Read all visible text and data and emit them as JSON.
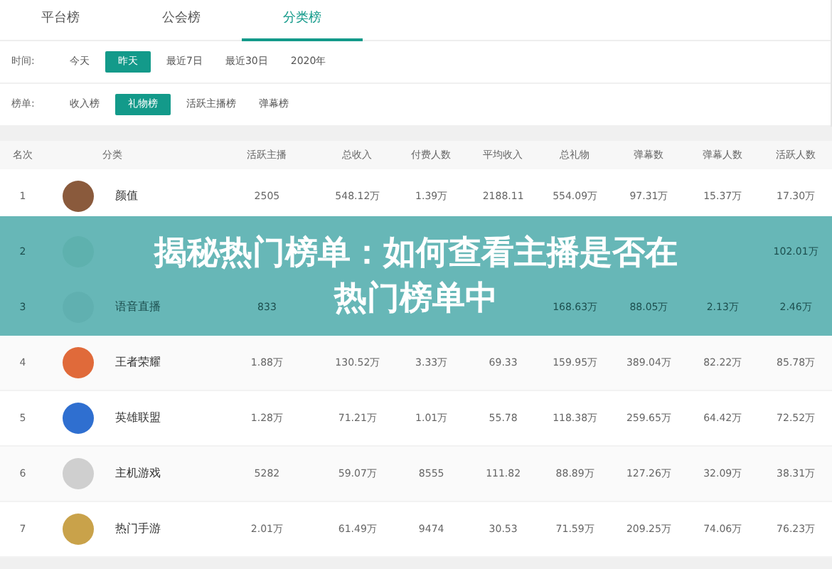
{
  "tabs": [
    {
      "label": "平台榜",
      "selected": false
    },
    {
      "label": "公会榜",
      "selected": false
    },
    {
      "label": "分类榜",
      "selected": true
    }
  ],
  "filters": [
    {
      "label": "时间:",
      "options": [
        {
          "label": "今天",
          "selected": false
        },
        {
          "label": "昨天",
          "selected": true
        },
        {
          "label": "最近7日",
          "selected": false
        },
        {
          "label": "最近30日",
          "selected": false
        },
        {
          "label": "2020年",
          "selected": false
        }
      ]
    },
    {
      "label": "榜单:",
      "options": [
        {
          "label": "收入榜",
          "selected": false
        },
        {
          "label": "礼物榜",
          "selected": true
        },
        {
          "label": "活跃主播榜",
          "selected": false
        },
        {
          "label": "弹幕榜",
          "selected": false
        }
      ]
    }
  ],
  "table": {
    "columns": [
      "名次",
      "分类",
      "活跃主播",
      "总收入",
      "付费人数",
      "平均收入",
      "总礼物",
      "弹幕数",
      "弹幕人数",
      "活跃人数"
    ],
    "rows": [
      [
        "1",
        "颜值",
        "2505",
        "548.12万",
        "1.39万",
        "2188.11",
        "554.09万",
        "97.31万",
        "15.37万",
        "17.30万"
      ],
      [
        "2",
        "",
        "",
        "",
        "",
        "",
        "",
        "",
        "",
        "102.01万"
      ],
      [
        "3",
        "语音直播",
        "833",
        "",
        "",
        "",
        "168.63万",
        "88.05万",
        "2.13万",
        "2.46万"
      ],
      [
        "4",
        "王者荣耀",
        "1.88万",
        "130.52万",
        "3.33万",
        "69.33",
        "159.95万",
        "389.04万",
        "82.22万",
        "85.78万"
      ],
      [
        "5",
        "英雄联盟",
        "1.28万",
        "71.21万",
        "1.01万",
        "55.78",
        "118.38万",
        "259.65万",
        "64.42万",
        "72.52万"
      ],
      [
        "6",
        "主机游戏",
        "5282",
        "59.07万",
        "8555",
        "111.82",
        "88.89万",
        "127.26万",
        "32.09万",
        "38.31万"
      ],
      [
        "7",
        "热门手游",
        "2.01万",
        "61.49万",
        "9474",
        "30.53",
        "71.59万",
        "209.25万",
        "74.06万",
        "76.23万"
      ]
    ]
  },
  "banner": {
    "lines": [
      "揭秘热门榜单：如何查看主播是否在",
      "热门榜单中"
    ]
  }
}
